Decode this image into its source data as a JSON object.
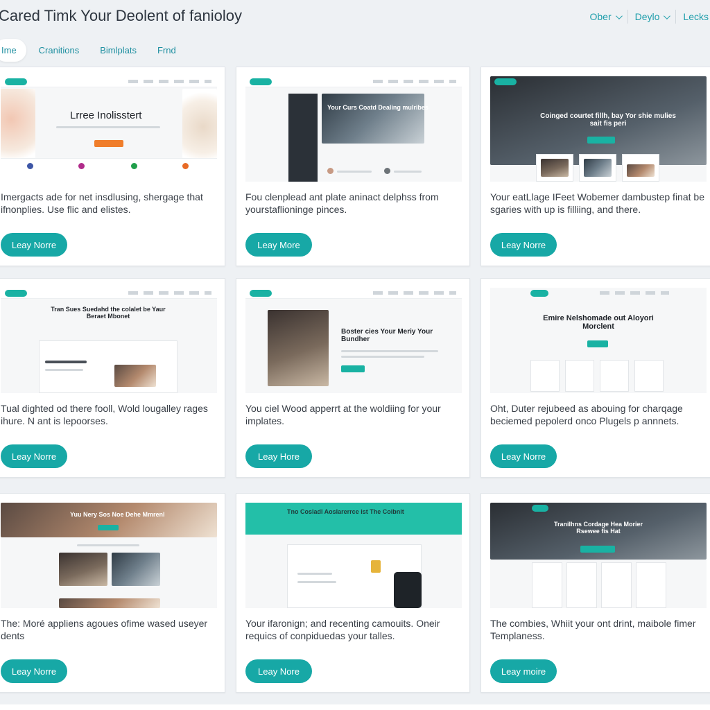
{
  "header": {
    "title": "Cared Timk Your Deolent of fanioloy",
    "menu": [
      {
        "label": "Ober",
        "has_dropdown": true
      },
      {
        "label": "Deylo",
        "has_dropdown": true
      },
      {
        "label": "Lecks",
        "has_dropdown": false
      }
    ]
  },
  "tabs": [
    {
      "label": "Ime",
      "active": true
    },
    {
      "label": "Cranitions",
      "active": false
    },
    {
      "label": "Bimlplats",
      "active": false
    },
    {
      "label": "Frnd",
      "active": false
    }
  ],
  "cards": [
    {
      "thumb_heading": "Lrree Inolisstert",
      "description": "Imergacts ade for net insdlusing, shergage that ifnonplies. Use flic and elistes.",
      "button": "Leay Norre"
    },
    {
      "thumb_heading": "Your Curs Coatd Dealing mulribes",
      "description": "Fou clenplead ant plate aninact delphss from yourstaflioninge pinces.",
      "button": "Leay More"
    },
    {
      "thumb_heading": "Coinged courtet fillh, bay Yor shie mulies sait fis peri",
      "description": "Your eatLlage IFeet Wobemer dambustep finat be sgaries with up is filliing, and there.",
      "button": "Leay Norre"
    },
    {
      "thumb_heading": "Tran Sues Suedahd the colalet be Yaur Beraet Mbonet",
      "description": "Tual dighted od there fooll, Wold lougalley rages ihure. N ant is lepoorses.",
      "button": "Leay Norre"
    },
    {
      "thumb_heading": "Boster cies Your Meriy Your Bundher",
      "description": "You ciel Wood apperrt at the woldiing for your implates.",
      "button": "Leay Hore"
    },
    {
      "thumb_heading": "Emire Nelshomade out Aloyori Morclent",
      "description": "Oht, Duter rejubeed as abouing for charqage beciemed pepolerd onco Plugels p annnets.",
      "button": "Leay Norre"
    },
    {
      "thumb_heading": "Yuu Nery Sos Noe Dehe Mmrenl",
      "description": "The: Moré appliens agoues ofime wased useyer dents",
      "button": "Leay Norre"
    },
    {
      "thumb_heading": "Tno Cosladl Aoslarerrce ist The Coibnit",
      "description": "Your ifaronign; and recenting camouits. Oneir requics of conpiduedas your talles.",
      "button": "Leay Nore"
    },
    {
      "thumb_heading": "Tranilhns Cordage Hea Morier Rsewee fis Hat",
      "description": "The combies, Whiit your ont drint, maibole fimer Templaness.",
      "button": "Leay moire"
    }
  ],
  "colors": {
    "accent": "#17a8a6",
    "link": "#1e9eab",
    "background": "#eef1f4"
  }
}
